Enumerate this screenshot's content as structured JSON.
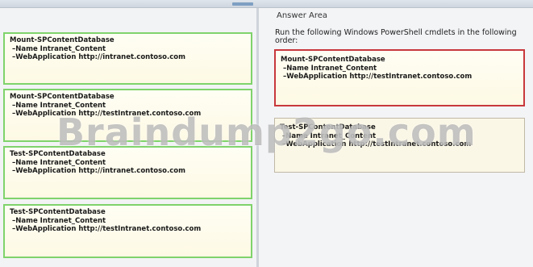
{
  "answer_area": {
    "title": "Answer Area",
    "instructions": "Run the following Windows PowerShell cmdlets in the following order:"
  },
  "choices": [
    {
      "cmdlet": "Mount-SPContentDatabase",
      "name_line": "–Name Intranet_Content",
      "webapp_line": "–WebApplication http://intranet.contoso.com"
    },
    {
      "cmdlet": "Mount-SPContentDatabase",
      "name_line": "–Name Intranet_Content",
      "webapp_line": "–WebApplication http://testIntranet.contoso.com"
    },
    {
      "cmdlet": "Test-SPContentDatabase",
      "name_line": "–Name Intranet_Content",
      "webapp_line": "–WebApplication http://intranet.contoso.com"
    },
    {
      "cmdlet": "Test-SPContentDatabase",
      "name_line": "–Name Intranet_Content",
      "webapp_line": "–WebApplication http://testIntranet.contoso.com"
    }
  ],
  "answers": [
    {
      "cmdlet": "Mount-SPContentDatabase",
      "name_line": "–Name Intranet_Content",
      "webapp_line": "–WebApplication http://testIntranet.contoso.com"
    },
    {
      "cmdlet": "Test-SPContentDatabase",
      "name_line": "–Name Intranet_Content",
      "webapp_line": "–WebApplication http://testIntranet.contoso.com"
    }
  ],
  "watermark": "Braindump2go.com",
  "colors": {
    "choice_border": "#7fd36b",
    "selected_border": "#c8383c",
    "card_background": "#fdf9e4"
  }
}
